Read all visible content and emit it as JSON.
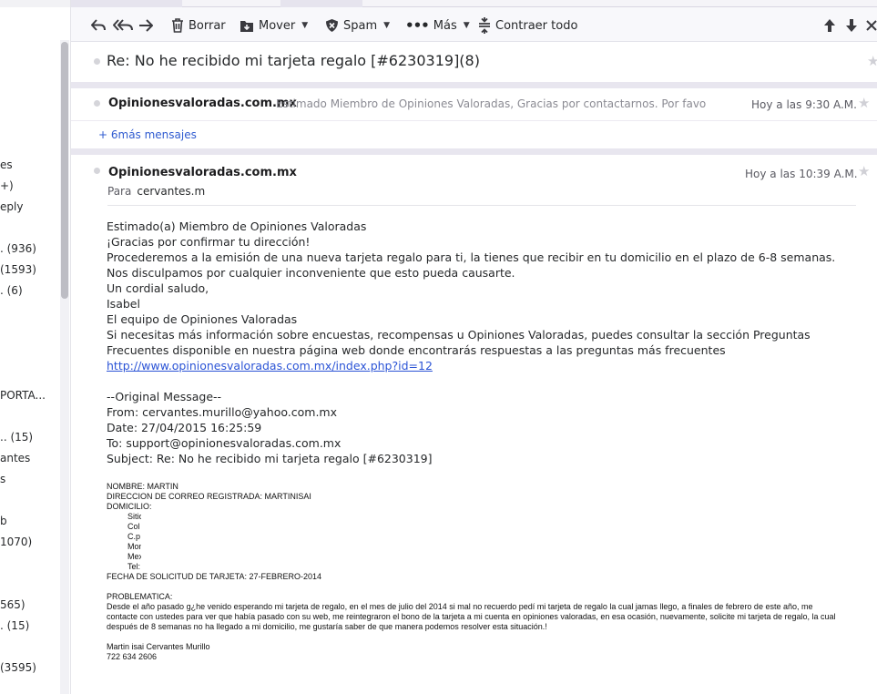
{
  "sidebar": {
    "items": [
      {
        "text": "es"
      },
      {
        "text": "+)"
      },
      {
        "text": "eply"
      },
      {
        "text": ".  (936)"
      },
      {
        "text": "(1593)"
      },
      {
        "text": ".  (6)"
      },
      {
        "text": "PORTA..."
      },
      {
        "text": "..  (15)"
      },
      {
        "text": "antes"
      },
      {
        "text": "s"
      },
      {
        "text": "b"
      },
      {
        "text": "1070)"
      },
      {
        "text": "565)"
      },
      {
        "text": ".  (15)"
      },
      {
        "text": "(3595)"
      }
    ]
  },
  "toolbar": {
    "delete_label": "Borrar",
    "move_label": "Mover",
    "spam_label": "Spam",
    "more_label": "Más",
    "collapse_label": "Contraer todo"
  },
  "subject": "Re: No he recibido mi tarjeta regalo [#6230319](8)",
  "collapsed_message": {
    "sender": "Opinionesvaloradas.com.mx",
    "snippet": "Estimado Miembro de Opiniones Valoradas, Gracias por contactarnos. Por favor co",
    "time": "Hoy a las 9:30 A.M."
  },
  "more_messages_label": "+ 6más mensajes",
  "message": {
    "sender": "Opinionesvaloradas.com.mx",
    "time": "Hoy a las 10:39 A.M.",
    "to_label": "Para",
    "to_address": "cervantes.m",
    "body": {
      "l1": "Estimado(a) Miembro de Opiniones Valoradas",
      "l2": "¡Gracias por confirmar tu dirección!",
      "l3": "Procederemos a la emisión de una nueva tarjeta regalo para ti, la tienes que recibir en tu domicilio en el plazo de 6-8 semanas. Nos disculpamos por cualquier inconveniente que esto pueda causarte.",
      "l4": "Un cordial saludo,",
      "l5": "Isabel",
      "l6": "El equipo de Opiniones Valoradas",
      "l7": "Si necesitas más información sobre encuestas, recompensas u Opiniones Valoradas, puedes consultar la sección Preguntas Frecuentes disponible en nuestra página web donde encontrarás respuestas a las preguntas más frecuentes",
      "link": "http://www.opinionesvaloradas.com.mx/index.php?id=12",
      "orig_header": "--Original Message--",
      "from": "From: cervantes.murillo@yahoo.com.mx",
      "date": "Date: 27/04/2015 16:25:59",
      "to": "To: support@opinionesvaloradas.com.mx",
      "subj": "Subject: Re: No he recibido mi tarjeta regalo [#6230319]"
    },
    "quoted": {
      "nombre": "NOMBRE: MARTIN",
      "direccion": "DIRECCION DE CORREO REGISTRADA: MARTINISAI",
      "domicilio": "DOMICILIO:",
      "sub_items": [
        "Sitio",
        "Col",
        "C.p",
        "Mon",
        "Mex",
        "Tel:"
      ],
      "fecha": "FECHA DE SOLICITUD DE TARJETA: 27-FEBRERO-2014",
      "problematica_label": "PROBLEMATICA:",
      "problematica_text": "Desde el año pasado g¿he venido esperando mi tarjeta de regalo, en el mes de julio del 2014 si mal no recuerdo pedí mi tarjeta de regalo la cual jamas llego, a finales de febrero de este año, me contacte con ustedes para ver que había pasado con su web, me reintegraron el bono de la tarjeta a mi cuenta en opiniones valoradas, en esa ocasión, nuevamente, solicite mi tarjeta de regalo, la cual después de 8 semanas no ha llegado a mi domicilio, me gustaría saber de que manera podemos resolver esta situación.!",
      "signature_name": "Martin isai Cervantes Murillo",
      "signature_phone": "722 634 2606"
    }
  }
}
